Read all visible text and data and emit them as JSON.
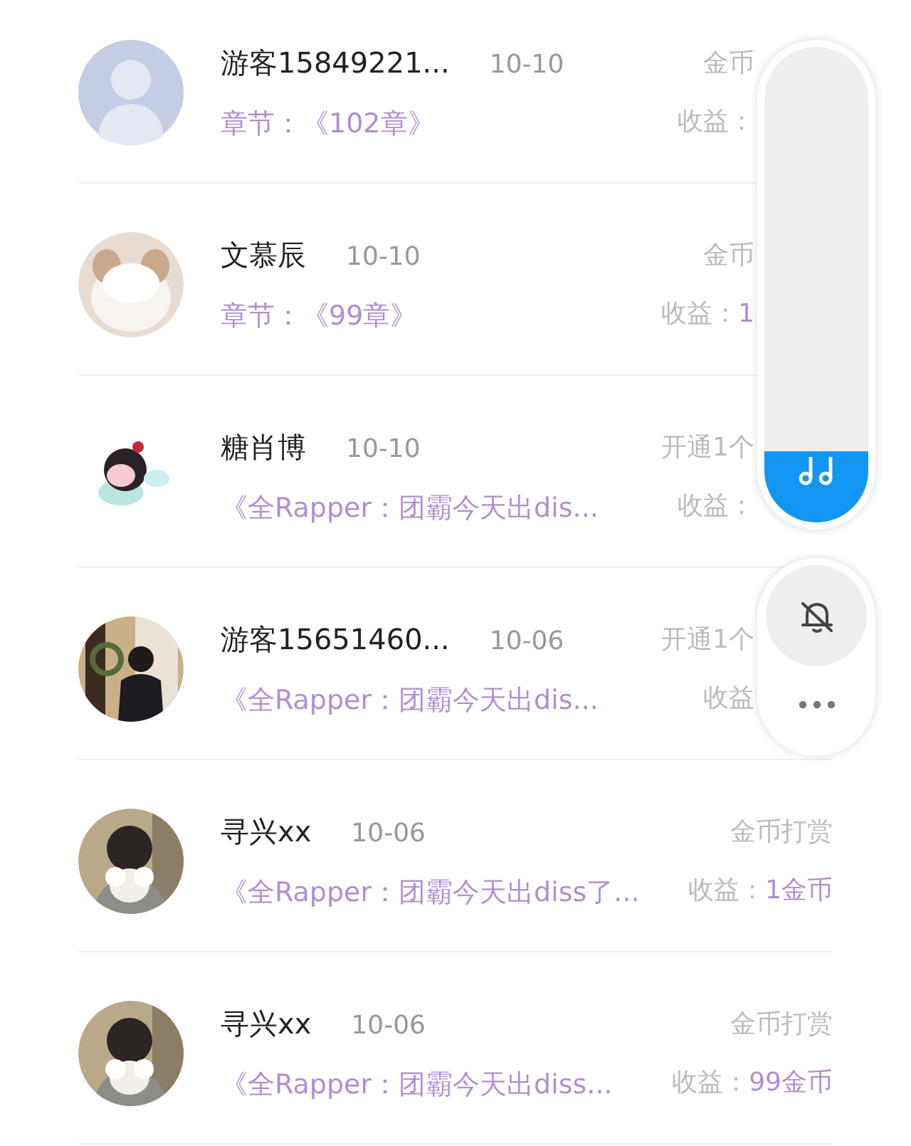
{
  "rows": [
    {
      "avatar": {
        "kind": "default"
      },
      "name": "游客15849221...",
      "date": "10-10",
      "type": "金币",
      "subtitle": "章节：《102章》",
      "earnings_label": "收益：",
      "earnings_value": ""
    },
    {
      "name": "文慕辰",
      "date": "10-10",
      "type": "金币",
      "subtitle": "章节：《99章》",
      "earnings_label": "收益：",
      "earnings_value": "1"
    },
    {
      "name": "糖肖博",
      "date": "10-10",
      "type": "开通1个",
      "subtitle": "《全Rapper：团霸今天出dis...",
      "earnings_label": "收益：",
      "earnings_value": ""
    },
    {
      "name": "游客15651460...",
      "date": "10-06",
      "type": "开通1个",
      "subtitle": "《全Rapper：团霸今天出dis...",
      "earnings_label": "收益",
      "earnings_value": ""
    },
    {
      "name": "寻兴xx",
      "date": "10-06",
      "type": "金币打赏",
      "subtitle": "《全Rapper：团霸今天出diss了...",
      "earnings_label": "收益：",
      "earnings_value": "1金币"
    },
    {
      "name": "寻兴xx",
      "date": "10-06",
      "type": "金币打赏",
      "subtitle": "《全Rapper：团霸今天出diss...",
      "earnings_label": "收益：",
      "earnings_value": "99金币"
    }
  ],
  "volume_panel": {
    "level": 0.15
  }
}
